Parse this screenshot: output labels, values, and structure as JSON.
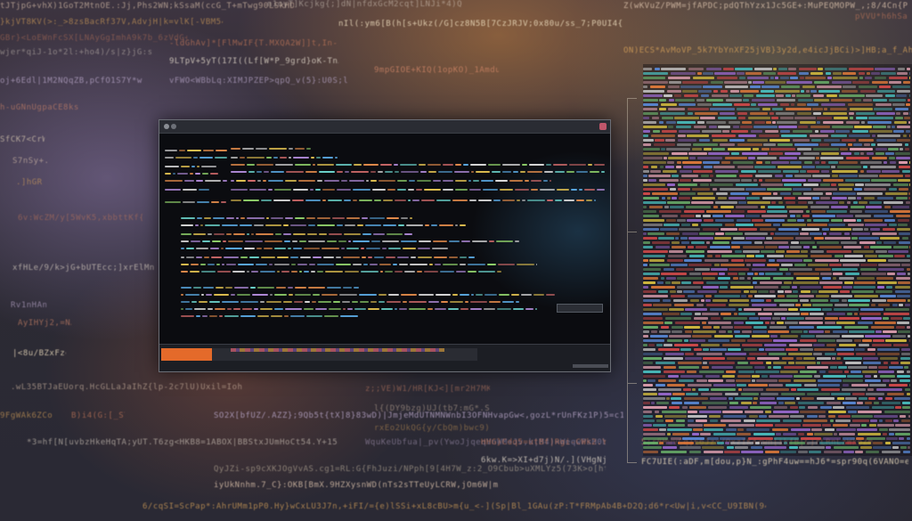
{
  "window": {
    "title": "",
    "heading": ""
  },
  "progress": {
    "fraction": 0.16,
    "color": "#e46a2a"
  },
  "palette": {
    "background": "#2c2a33",
    "warm_glow": "#c8823c",
    "cool_glow": "#8c78aa",
    "terminal_bg": "#0b0c10",
    "frame": "#6b6e76"
  },
  "icons": {
    "close": "close-icon",
    "window_menu": "window-menu-icon"
  }
}
